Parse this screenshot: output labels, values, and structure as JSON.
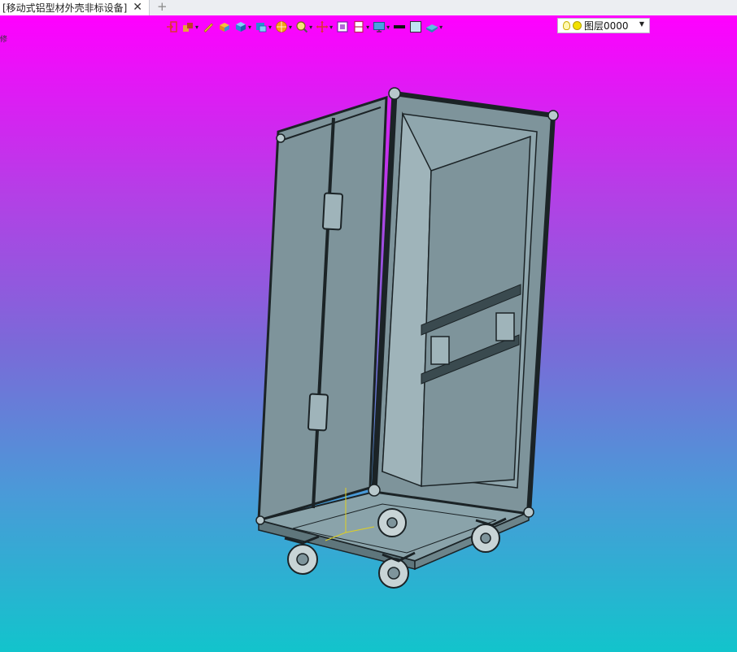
{
  "tab": {
    "title": "[移动式铝型材外壳非标设备]",
    "close_glyph": "✕",
    "add_glyph": "+"
  },
  "viewport": {
    "side_mark": "修",
    "gradient_top": "#ff00ff",
    "gradient_bottom": "#12c4cc"
  },
  "toolbar": {
    "tools": [
      "exit-icon",
      "assembly-icon",
      "pen-icon",
      "extrude-icon",
      "solid-box-icon",
      "surface-icon",
      "render-sphere-icon",
      "zoom-icon",
      "move-icon",
      "fit-view-icon",
      "section-icon",
      "monitor-icon"
    ],
    "line_color": "#111111",
    "fill_color": "#bfe4f2",
    "layer_label": "图层0000"
  },
  "model": {
    "name": "flight-case-cabinet",
    "body_color": "#7e949b",
    "panel_color": "#8fa6ad",
    "edge_color": "#1b2326"
  }
}
